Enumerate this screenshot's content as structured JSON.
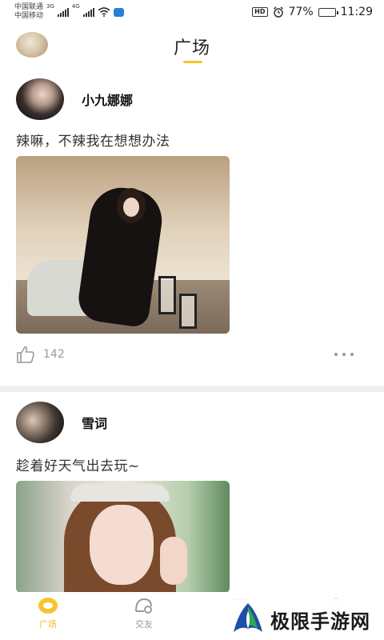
{
  "status_bar": {
    "carrier_1": "中国联通",
    "carrier_2": "中国移动",
    "net_1": "3G",
    "net_2": "4G",
    "hd": "HD",
    "battery": "77%",
    "battery_level": 0.77,
    "time": "11:29",
    "icons": [
      "signal-icon",
      "wifi-icon",
      "app-notification-icon",
      "alarm-icon",
      "battery-icon"
    ]
  },
  "header": {
    "title": "广场",
    "accent_color": "#f6c42c"
  },
  "posts": [
    {
      "username": "小九娜娜",
      "text": "辣嘛，不辣我在想想办法",
      "likes": "142"
    },
    {
      "username": "雪词",
      "text": "趁着好天气出去玩~"
    }
  ],
  "tabs": [
    {
      "label": "广场",
      "icon": "plaza-icon",
      "active": true
    },
    {
      "label": "交友",
      "icon": "friends-icon",
      "active": false
    },
    {
      "label": "",
      "icon": "message-icon",
      "active": false
    },
    {
      "label": "",
      "icon": "profile-icon",
      "active": false
    }
  ],
  "watermark": {
    "text": "极限手游网"
  },
  "colors": {
    "active_tab": "#f6b91e",
    "inactive": "#999999"
  }
}
